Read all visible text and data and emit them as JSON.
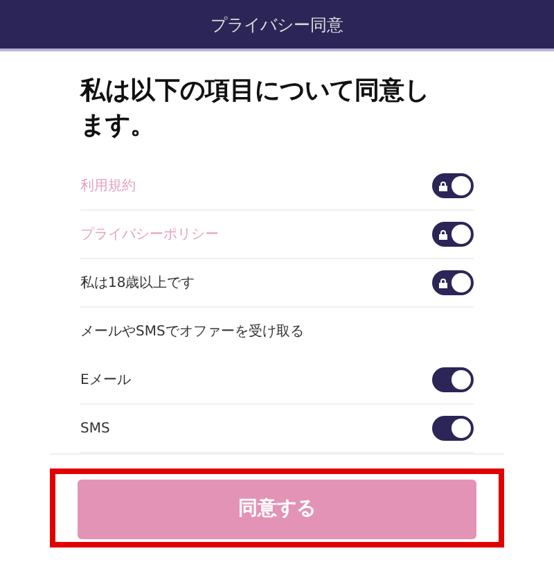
{
  "header": {
    "title": "プライバシー同意"
  },
  "heading": "私は以下の項目について同意します。",
  "rows": [
    {
      "kind": "toggle",
      "label": "利用規約",
      "link": true,
      "checked": true,
      "locked": true
    },
    {
      "kind": "toggle",
      "label": "プライバシーポリシー",
      "link": true,
      "checked": true,
      "locked": true
    },
    {
      "kind": "toggle",
      "label": "私は18歳以上です",
      "link": false,
      "checked": true,
      "locked": true
    },
    {
      "kind": "heading",
      "label": "メールやSMSでオファーを受け取る"
    },
    {
      "kind": "toggle",
      "label": "Eメール",
      "link": false,
      "checked": true,
      "locked": false
    },
    {
      "kind": "toggle",
      "label": "SMS",
      "link": false,
      "checked": true,
      "locked": false
    }
  ],
  "agree_button": {
    "label": "同意する",
    "highlighted": true
  }
}
